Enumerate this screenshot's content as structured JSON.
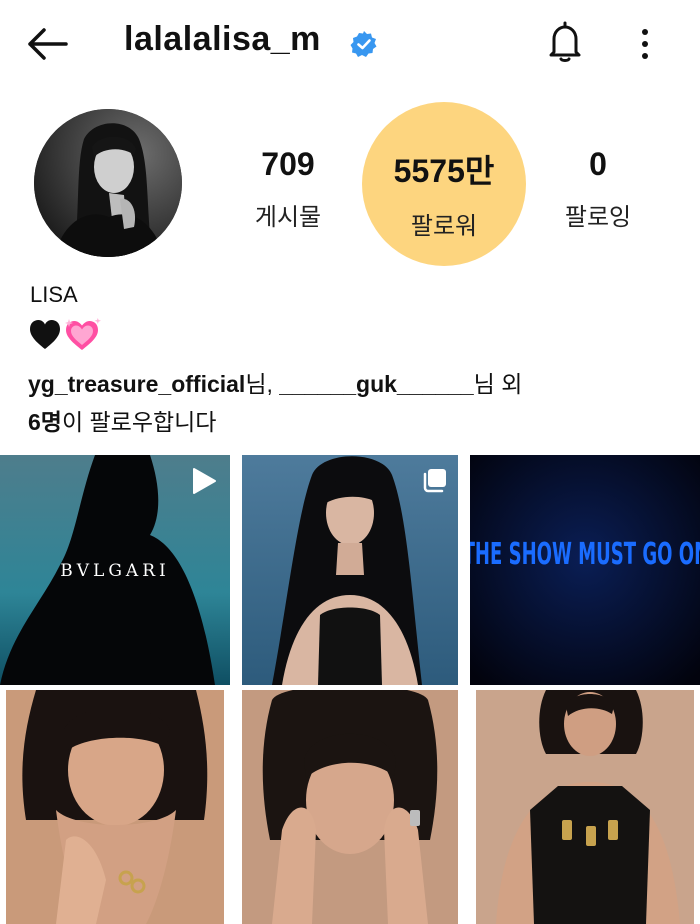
{
  "header": {
    "username": "lalalalisa_m"
  },
  "stats": {
    "posts_count": "709",
    "posts_label": "게시물",
    "followers_count": "5575만",
    "followers_label": "팔로워",
    "following_count": "0",
    "following_label": "팔로잉"
  },
  "bio": {
    "name": "LISA",
    "emoji": [
      "black-heart",
      "sparkling-heart"
    ]
  },
  "followed_by": {
    "user1": "yg_treasure_official",
    "sep1": "님, ",
    "user2": "______guk______",
    "sep2": "님 외",
    "count": "6명",
    "suffix": "이 팔로우합니다"
  },
  "grid": {
    "tile1_text": "BVLGARI",
    "tile3_text": "THE SHOW MUST GO ON",
    "tile1_badge": "play-icon",
    "tile2_badge": "multi-image-icon"
  },
  "colors": {
    "verified": "#3897f0",
    "followers_highlight": "#fdd57f",
    "neon_blue": "#1a6cff"
  }
}
